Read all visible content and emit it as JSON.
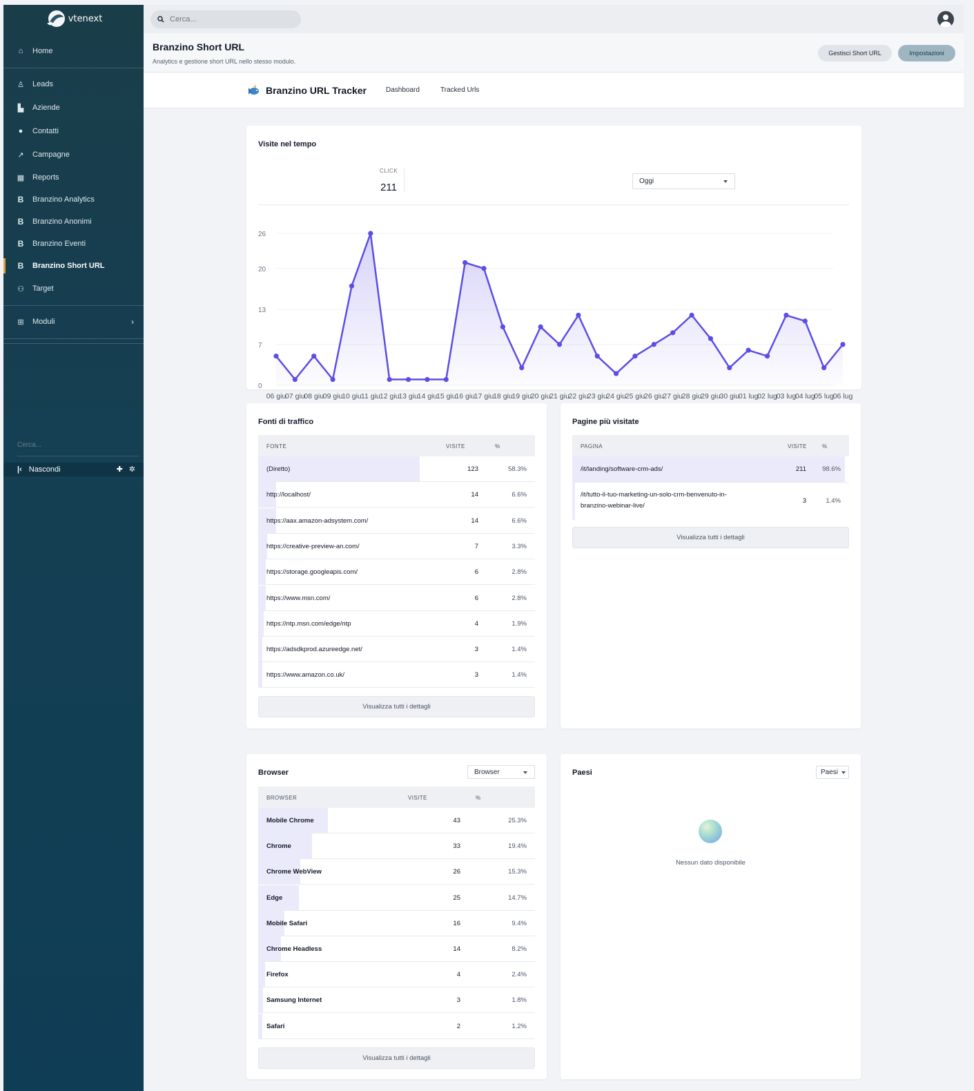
{
  "sidebar": {
    "logo_text": "vtenext",
    "items": [
      {
        "label": "Home",
        "icon": "home-icon"
      },
      {
        "label": "Leads",
        "icon": "user-icon"
      },
      {
        "label": "Aziende",
        "icon": "building-icon"
      },
      {
        "label": "Contatti",
        "icon": "person-icon"
      },
      {
        "label": "Campagne",
        "icon": "trend-icon"
      },
      {
        "label": "Reports",
        "icon": "table-icon"
      },
      {
        "label": "Branzino Analytics",
        "icon": "b-icon"
      },
      {
        "label": "Branzino Anonimi",
        "icon": "b-icon"
      },
      {
        "label": "Branzino Eventi",
        "icon": "b-icon"
      },
      {
        "label": "Branzino Short URL",
        "icon": "b-icon"
      },
      {
        "label": "Target",
        "icon": "users-plus-icon"
      },
      {
        "label": "Moduli",
        "icon": "grid-icon"
      }
    ],
    "search_placeholder": "Cerca...",
    "hide_label": "Nascondi"
  },
  "topbar": {
    "search_placeholder": "Cerca..."
  },
  "header": {
    "title": "Branzino Short URL",
    "subtitle": "Analytics e gestione short URL nello stesso modulo.",
    "manage_button": "Gestisci Short URL",
    "settings_button": "Impostazioni"
  },
  "tracker": {
    "name": "Branzino URL Tracker",
    "tabs": [
      "Dashboard",
      "Tracked Urls"
    ]
  },
  "visits": {
    "title": "Visite nel tempo",
    "click_label": "CLICK",
    "click_value": "211",
    "period": "Oggi"
  },
  "chart_data": {
    "type": "area",
    "x": [
      "06 giu",
      "07 giu",
      "08 giu",
      "09 giu",
      "10 giu",
      "11 giu",
      "12 giu",
      "13 giu",
      "14 giu",
      "15 giu",
      "16 giu",
      "17 giu",
      "18 giu",
      "19 giu",
      "20 giu",
      "21 giu",
      "22 giu",
      "23 giu",
      "24 giu",
      "25 giu",
      "26 giu",
      "27 giu",
      "28 giu",
      "29 giu",
      "30 giu",
      "01 lug",
      "02 lug",
      "03 lug",
      "04 lug",
      "05 lug",
      "06 lug"
    ],
    "values": [
      5,
      1,
      5,
      1,
      17,
      26,
      1,
      1,
      1,
      1,
      21,
      20,
      10,
      3,
      10,
      7,
      12,
      5,
      2,
      5,
      7,
      9,
      12,
      8,
      3,
      6,
      5,
      12,
      11,
      3,
      7
    ],
    "yticks": [
      0,
      7,
      13,
      20,
      26
    ],
    "ylim": [
      0,
      26
    ],
    "color": "#5b4de6",
    "fill_color": "#c9c3f6"
  },
  "traffic": {
    "title": "Fonti di traffico",
    "columns": [
      "FONTE",
      "VISITE",
      "%"
    ],
    "rows": [
      {
        "label": "(Diretto)",
        "visits": "123",
        "pct": "58.3%",
        "share": 0.583
      },
      {
        "label": "http://localhost/",
        "visits": "14",
        "pct": "6.6%",
        "share": 0.066
      },
      {
        "label": "https://aax.amazon-adsystem.com/",
        "visits": "14",
        "pct": "6.6%",
        "share": 0.066
      },
      {
        "label": "https://creative-preview-an.com/",
        "visits": "7",
        "pct": "3.3%",
        "share": 0.033
      },
      {
        "label": "https://storage.googleapis.com/",
        "visits": "6",
        "pct": "2.8%",
        "share": 0.028
      },
      {
        "label": "https://www.msn.com/",
        "visits": "6",
        "pct": "2.8%",
        "share": 0.028
      },
      {
        "label": "https://ntp.msn.com/edge/ntp",
        "visits": "4",
        "pct": "1.9%",
        "share": 0.019
      },
      {
        "label": "https://adsdkprod.azureedge.net/",
        "visits": "3",
        "pct": "1.4%",
        "share": 0.014
      },
      {
        "label": "https://www.amazon.co.uk/",
        "visits": "3",
        "pct": "1.4%",
        "share": 0.014
      }
    ],
    "details_button": "Visualizza tutti i dettagli"
  },
  "pages": {
    "title": "Pagine più visitate",
    "columns": [
      "PAGINA",
      "VISITE",
      "%"
    ],
    "rows": [
      {
        "label": "/it/landing/software-crm-ads/",
        "visits": "211",
        "pct": "98.6%",
        "share": 0.986
      },
      {
        "label": "/it/tutto-il-tuo-marketing-un-solo-crm-benvenuto-in-",
        "label2": "branzino-webinar-live/",
        "visits": "3",
        "pct": "1.4%",
        "share": 0.014
      }
    ],
    "details_button": "Visualizza tutti i dettagli"
  },
  "browser": {
    "title": "Browser",
    "select": "Browser",
    "columns": [
      "BROWSER",
      "VISITE",
      "%"
    ],
    "rows": [
      {
        "label": "Mobile Chrome",
        "visits": "43",
        "pct": "25.3%",
        "share": 0.253
      },
      {
        "label": "Chrome",
        "visits": "33",
        "pct": "19.4%",
        "share": 0.194
      },
      {
        "label": "Chrome WebView",
        "visits": "26",
        "pct": "15.3%",
        "share": 0.153
      },
      {
        "label": "Edge",
        "visits": "25",
        "pct": "14.7%",
        "share": 0.147
      },
      {
        "label": "Mobile Safari",
        "visits": "16",
        "pct": "9.4%",
        "share": 0.094
      },
      {
        "label": "Chrome Headless",
        "visits": "14",
        "pct": "8.2%",
        "share": 0.082
      },
      {
        "label": "Firefox",
        "visits": "4",
        "pct": "2.4%",
        "share": 0.024
      },
      {
        "label": "Samsung Internet",
        "visits": "3",
        "pct": "1.8%",
        "share": 0.018
      },
      {
        "label": "Safari",
        "visits": "2",
        "pct": "1.2%",
        "share": 0.012
      }
    ],
    "details_button": "Visualizza tutti i dettagli"
  },
  "countries": {
    "title": "Paesi",
    "select": "Paesi",
    "empty": "Nessun dato disponibile"
  }
}
